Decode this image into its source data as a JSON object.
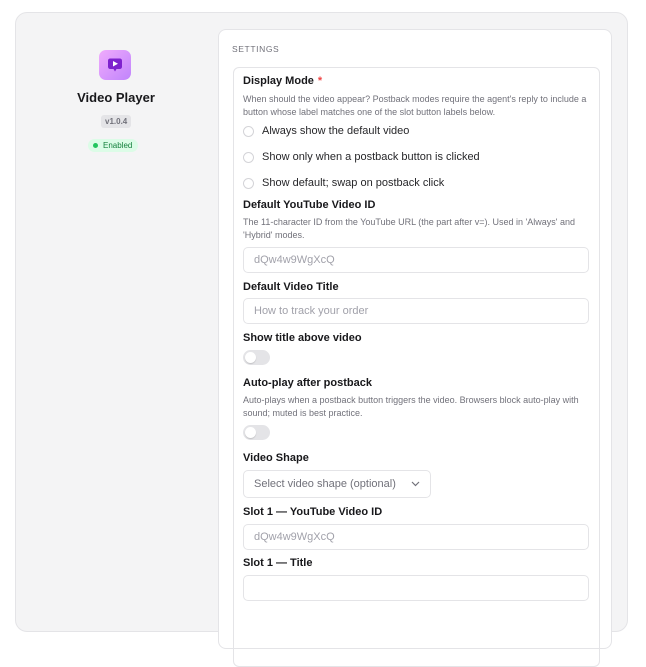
{
  "app": {
    "name": "Video Player",
    "version": "v1.0.4",
    "status": "Enabled",
    "icon": "video-play-icon"
  },
  "settings": {
    "section_title": "SETTINGS",
    "display_mode": {
      "label": "Display Mode",
      "required_mark": "*",
      "help": "When should the video appear? Postback modes require the agent's reply to include a button whose label matches one of the slot button labels below.",
      "options": [
        "Always show the default video",
        "Show only when a postback button is clicked",
        "Show default; swap on postback click"
      ]
    },
    "default_video_id": {
      "label": "Default YouTube Video ID",
      "help": "The 11-character ID from the YouTube URL (the part after v=). Used in 'Always' and 'Hybrid' modes.",
      "placeholder": "dQw4w9WgXcQ"
    },
    "default_video_title": {
      "label": "Default Video Title",
      "placeholder": "How to track your order"
    },
    "show_title": {
      "label": "Show title above video",
      "on": false
    },
    "autoplay": {
      "label": "Auto-play after postback",
      "help": "Auto-plays when a postback button triggers the video. Browsers block auto-play with sound; muted is best practice.",
      "on": false
    },
    "video_shape": {
      "label": "Video Shape",
      "placeholder": "Select video shape (optional)"
    },
    "slot1_video_id": {
      "label": "Slot 1 — YouTube Video ID",
      "placeholder": "dQw4w9WgXcQ"
    },
    "slot1_title": {
      "label": "Slot 1 — Title",
      "placeholder": ""
    }
  },
  "colors": {
    "accent": "#a855f7",
    "enabled": "#22c55e",
    "required": "#ef4444"
  }
}
